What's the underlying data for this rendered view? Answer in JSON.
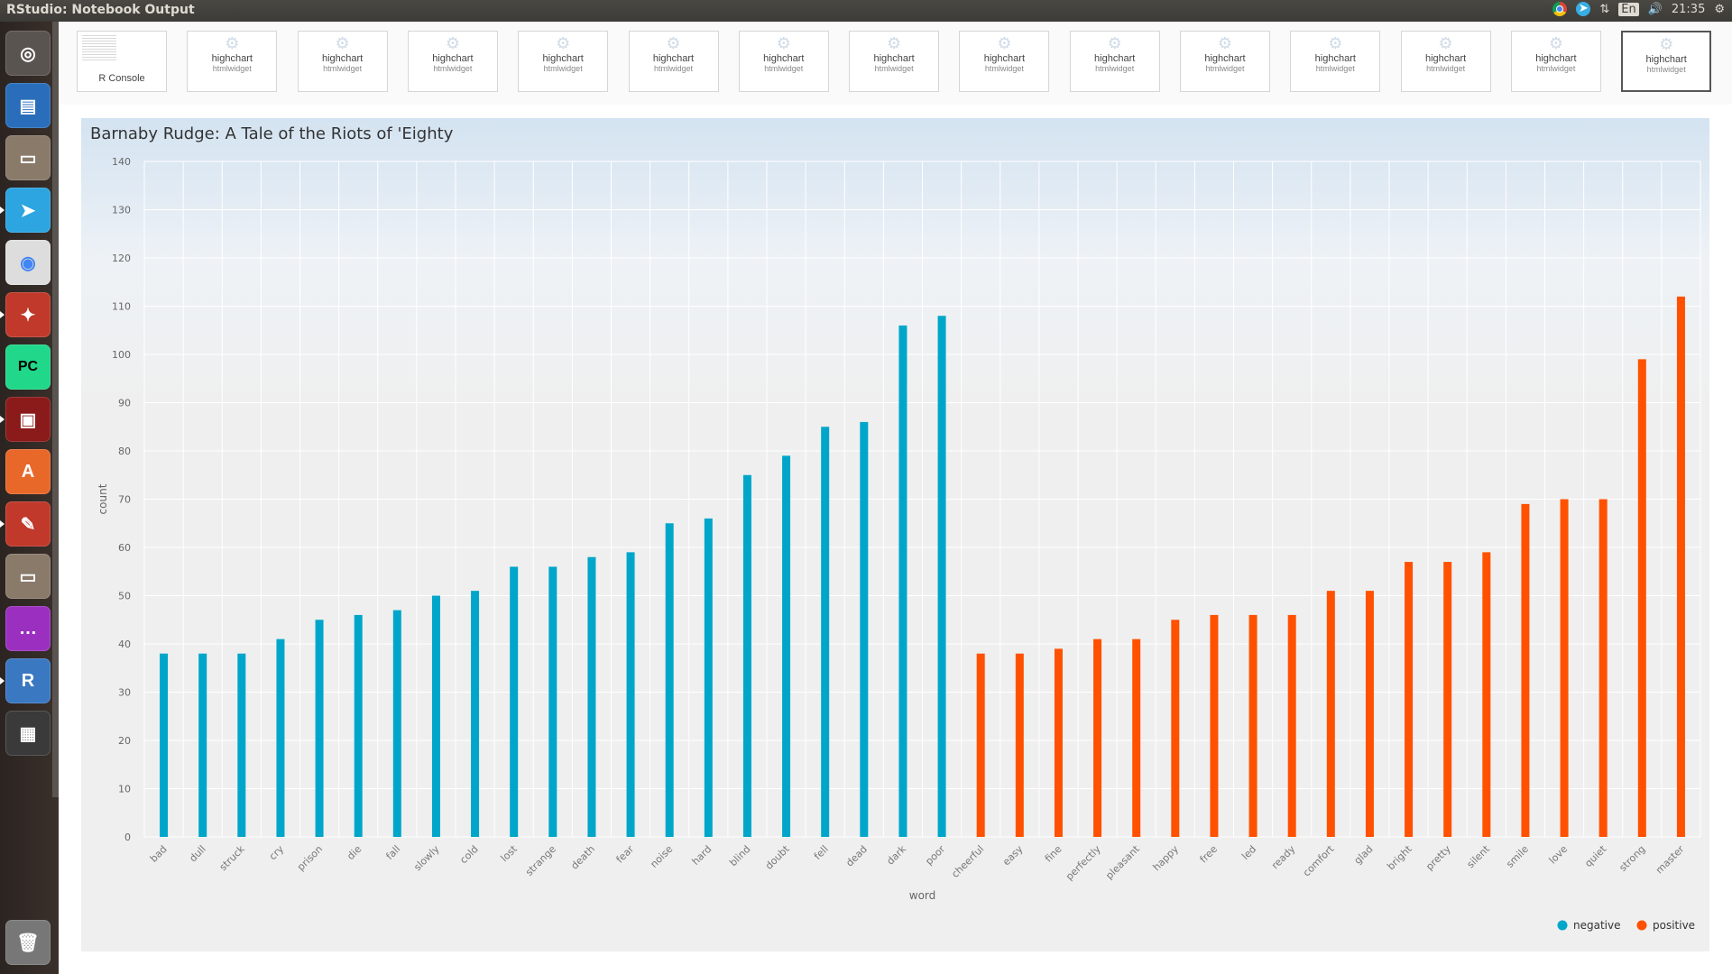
{
  "window": {
    "title": "RStudio: Notebook Output"
  },
  "system_tray": {
    "keyboard": "En",
    "clock": "21:35",
    "icons": [
      "chrome-icon",
      "telegram-icon",
      "network-icon",
      "keyboard-layout-icon",
      "volume-icon",
      "settings-icon"
    ]
  },
  "launcher": {
    "items": [
      {
        "name": "ubuntu-dash-icon",
        "color": "#5a5450",
        "glyph": "◎"
      },
      {
        "name": "libreoffice-writer-icon",
        "color": "#2a6ebb",
        "glyph": "▤"
      },
      {
        "name": "files-icon",
        "color": "#8a7a6a",
        "glyph": "▭"
      },
      {
        "name": "telegram-icon",
        "color": "#2ca5e0",
        "glyph": "➤"
      },
      {
        "name": "chrome-icon",
        "color": "#dddddd",
        "glyph": "◉"
      },
      {
        "name": "system-tools-icon",
        "color": "#c0392b",
        "glyph": "✦"
      },
      {
        "name": "pycharm-icon",
        "color": "#21d789",
        "glyph": "PC"
      },
      {
        "name": "terminal-icon",
        "color": "#8b1a1a",
        "glyph": "▣"
      },
      {
        "name": "software-center-icon",
        "color": "#e8682a",
        "glyph": "A"
      },
      {
        "name": "pdf-viewer-icon",
        "color": "#c0392b",
        "glyph": "✎"
      },
      {
        "name": "archive-icon",
        "color": "#8a7a6a",
        "glyph": "▭"
      },
      {
        "name": "chat-icon",
        "color": "#9b30c0",
        "glyph": "…"
      },
      {
        "name": "rstudio-icon",
        "color": "#3b78c2",
        "glyph": "R"
      },
      {
        "name": "workspace-switcher-icon",
        "color": "#3a3a3a",
        "glyph": "▦"
      },
      {
        "name": "trash-icon",
        "color": "#777777",
        "glyph": "🗑"
      }
    ]
  },
  "thumbnails": {
    "console_label": "R Console",
    "widget_title": "highchart",
    "widget_subtitle": "htmlwidget",
    "widget_count": 14,
    "selected_index": 14
  },
  "chart_data": {
    "type": "bar",
    "title": "Barnaby Rudge: A Tale of the Riots of 'Eighty",
    "xlabel": "word",
    "ylabel": "count",
    "ylim": [
      0,
      140
    ],
    "yticks": [
      0,
      10,
      20,
      30,
      40,
      50,
      60,
      70,
      80,
      90,
      100,
      110,
      120,
      130,
      140
    ],
    "grid": true,
    "legend_position": "bottom-right",
    "categories": [
      "bad",
      "dull",
      "struck",
      "cry",
      "prison",
      "die",
      "fall",
      "slowly",
      "cold",
      "lost",
      "strange",
      "death",
      "fear",
      "noise",
      "hard",
      "blind",
      "doubt",
      "fell",
      "dead",
      "dark",
      "poor",
      "cheerful",
      "easy",
      "fine",
      "perfectly",
      "pleasant",
      "happy",
      "free",
      "led",
      "ready",
      "comfort",
      "glad",
      "bright",
      "pretty",
      "silent",
      "smile",
      "love",
      "quiet",
      "strong",
      "master"
    ],
    "series": [
      {
        "name": "negative",
        "color": "#00a6c9",
        "values": [
          38,
          38,
          38,
          41,
          45,
          46,
          47,
          50,
          51,
          56,
          56,
          58,
          59,
          65,
          66,
          75,
          79,
          85,
          86,
          106,
          108,
          null,
          null,
          null,
          null,
          null,
          null,
          null,
          null,
          null,
          null,
          null,
          null,
          null,
          null,
          null,
          null,
          null,
          null,
          null
        ]
      },
      {
        "name": "positive",
        "color": "#ff5100",
        "values": [
          null,
          null,
          null,
          null,
          null,
          null,
          null,
          null,
          null,
          null,
          null,
          null,
          null,
          null,
          null,
          null,
          null,
          null,
          null,
          null,
          null,
          38,
          38,
          39,
          41,
          41,
          45,
          46,
          46,
          46,
          51,
          51,
          57,
          57,
          59,
          69,
          70,
          70,
          99,
          112
        ]
      }
    ]
  }
}
